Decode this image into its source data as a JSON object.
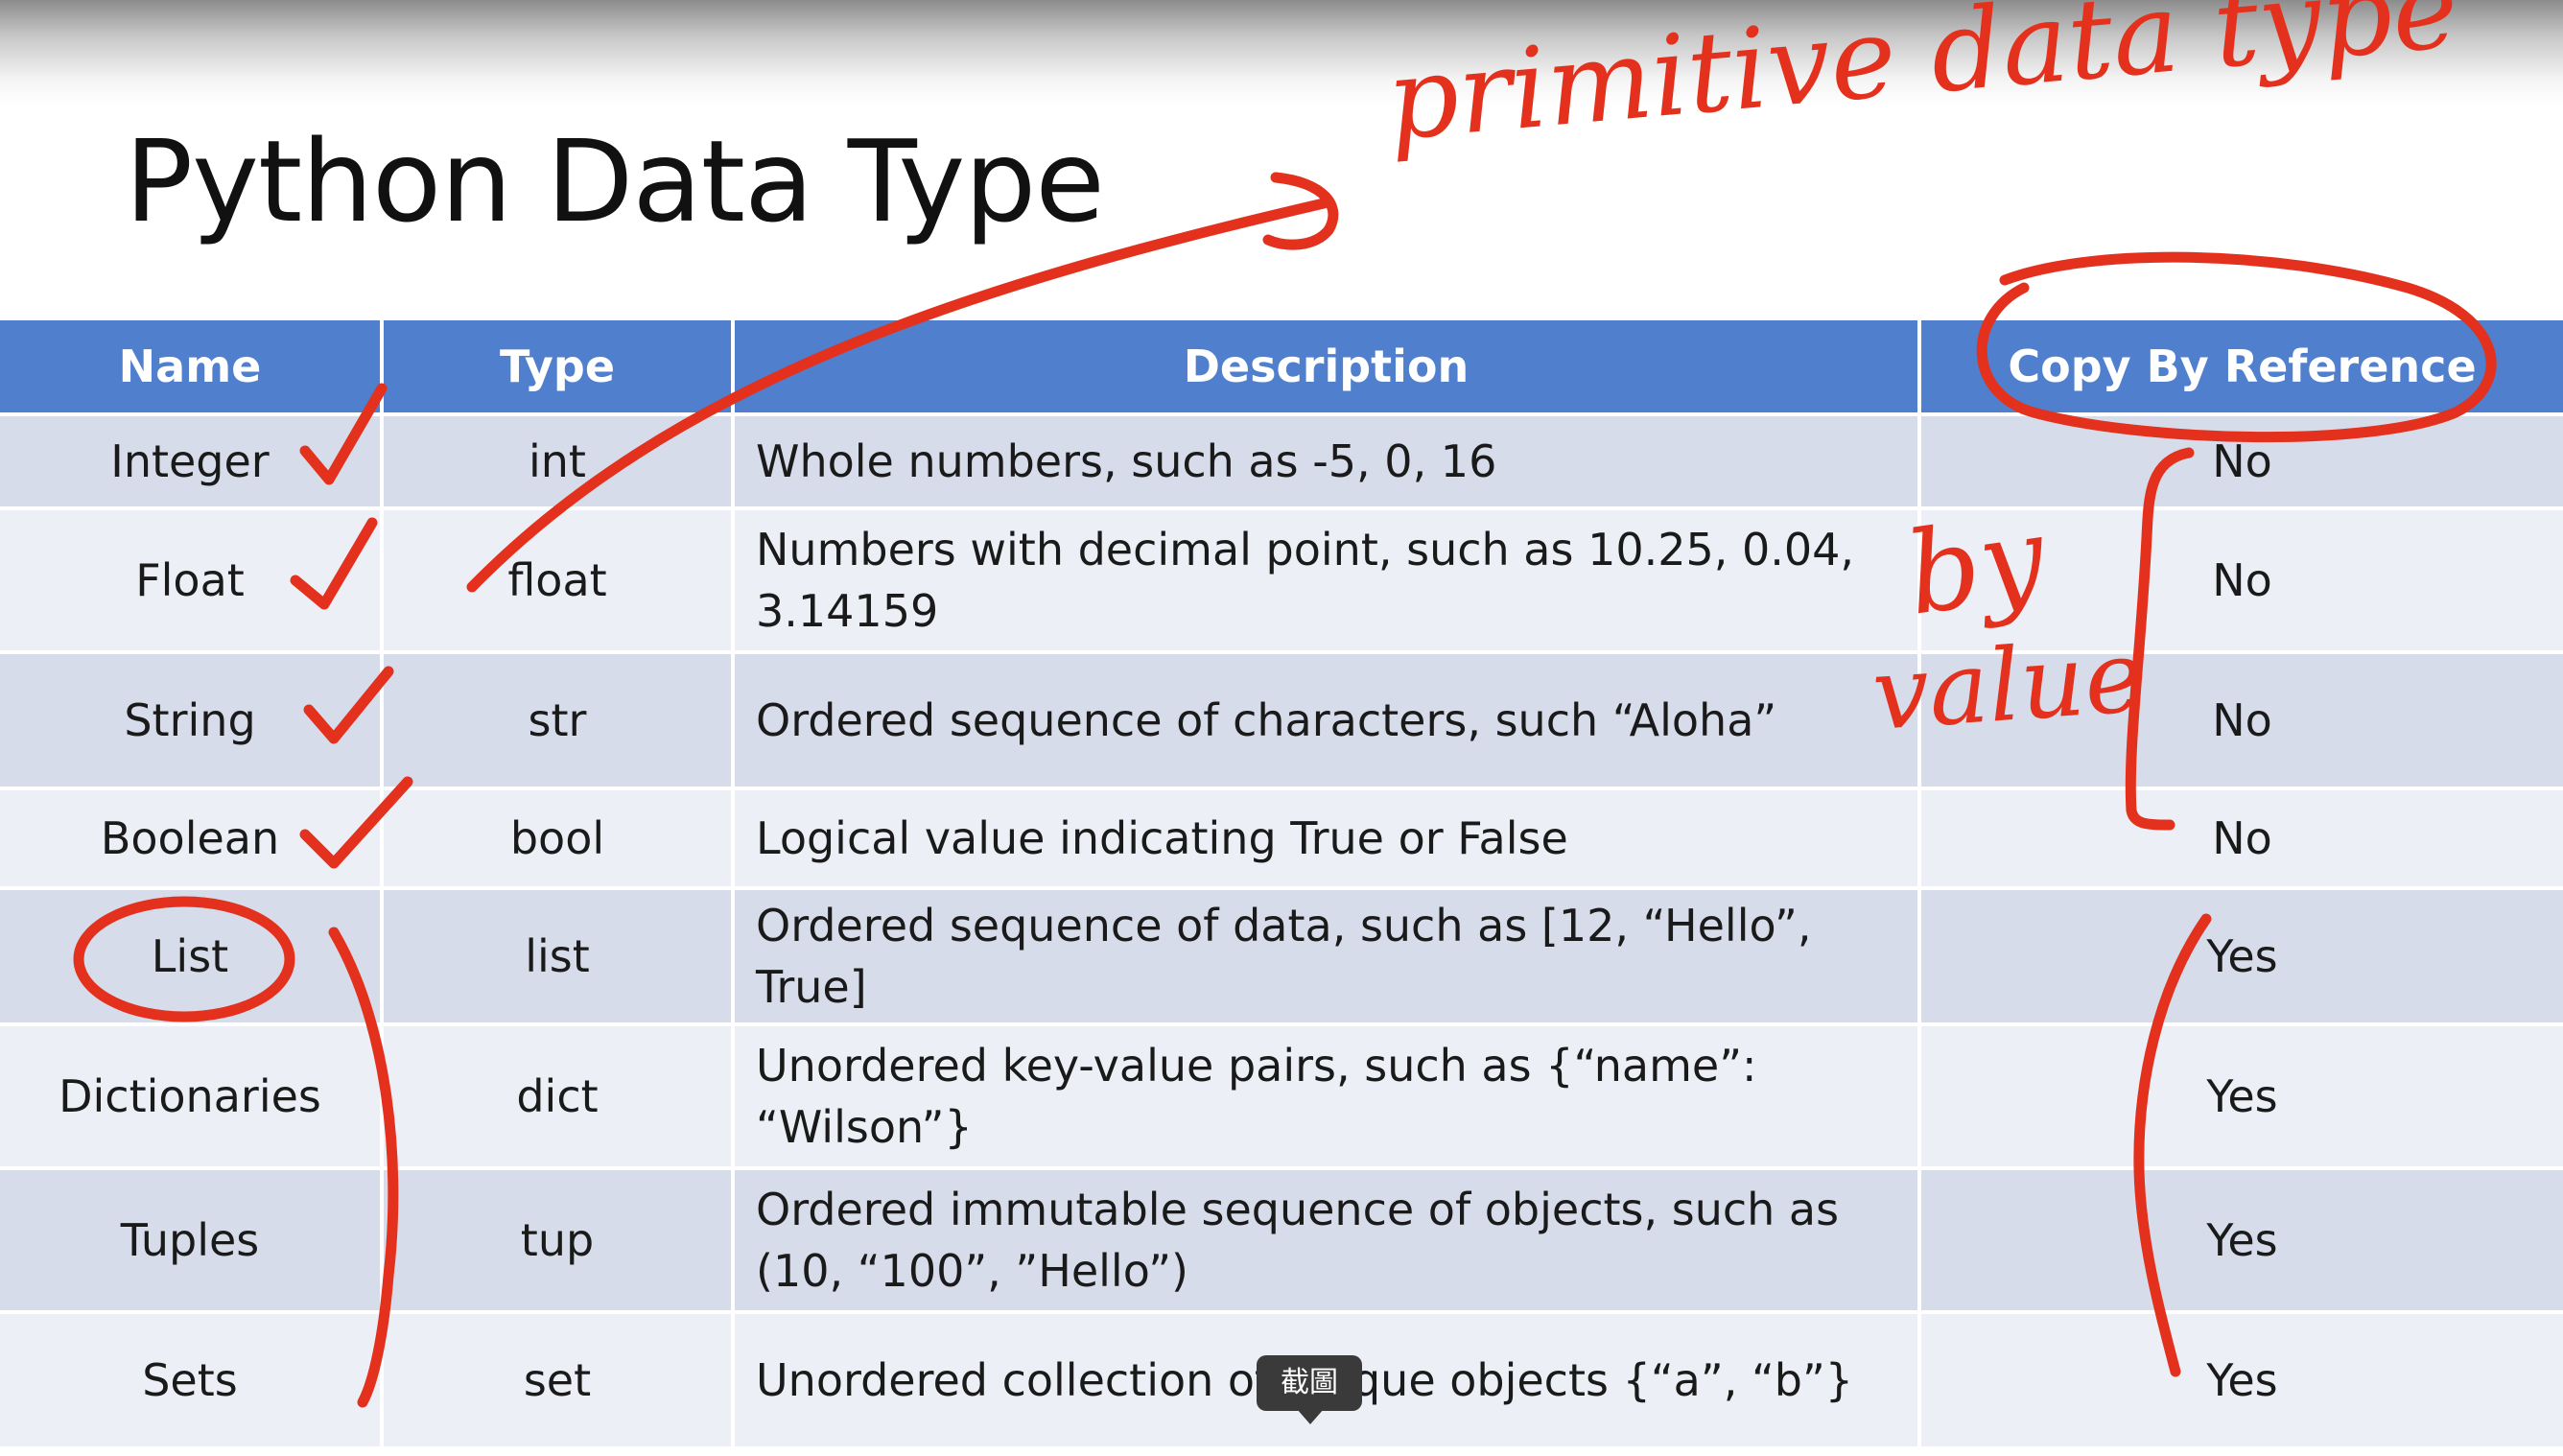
{
  "slide": {
    "title": "Python Data Type"
  },
  "table": {
    "headers": [
      "Name",
      "Type",
      "Description",
      "Copy By Reference"
    ],
    "rows": [
      {
        "name": "Integer",
        "type": "int",
        "description": "Whole numbers, such as -5, 0, 16",
        "copy_by_reference": "No"
      },
      {
        "name": "Float",
        "type": "float",
        "description": "Numbers with decimal point, such as 10.25, 0.04, 3.14159",
        "copy_by_reference": "No"
      },
      {
        "name": "String",
        "type": "str",
        "description": "Ordered sequence of characters, such “Aloha”",
        "copy_by_reference": "No"
      },
      {
        "name": "Boolean",
        "type": "bool",
        "description": "Logical value indicating True or False",
        "copy_by_reference": "No"
      },
      {
        "name": "List",
        "type": "list",
        "description": "Ordered sequence of data, such as [12, “Hello”, True]",
        "copy_by_reference": "Yes"
      },
      {
        "name": "Dictionaries",
        "type": "dict",
        "description": "Unordered key-value pairs, such as {“name”: “Wilson”}",
        "copy_by_reference": "Yes"
      },
      {
        "name": "Tuples",
        "type": "tup",
        "description": "Ordered immutable sequence of objects, such as (10, “100”, ”Hello”)",
        "copy_by_reference": "Yes"
      },
      {
        "name": "Sets",
        "type": "set",
        "description": "Unordered collection of unique objects {“a”, “b”}",
        "copy_by_reference": "Yes"
      }
    ]
  },
  "annotations": {
    "primitive_note": "primitive data type",
    "by_value_note_line1": "by",
    "by_value_note_line2": "value",
    "ink_color": "#e3311d"
  },
  "tooltip": {
    "label": "截圖"
  },
  "colors": {
    "header_bg": "#4f7fcd",
    "row_dark": "#d6dcea",
    "row_light": "#eceff6"
  }
}
